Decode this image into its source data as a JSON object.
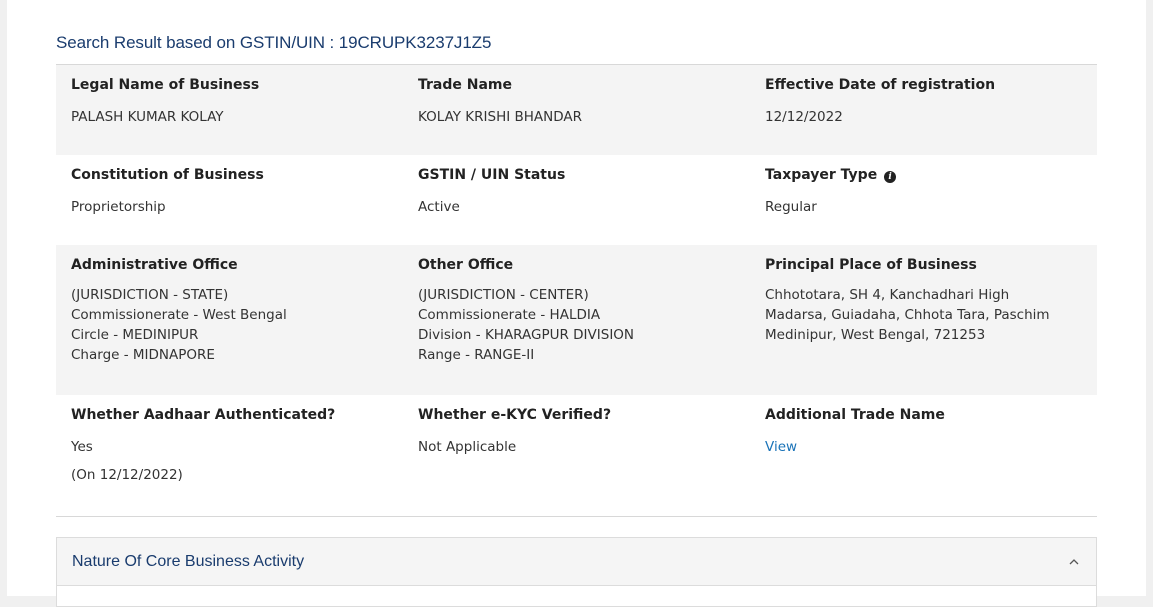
{
  "header": {
    "search_result_label": "Search Result based on GSTIN/UIN : 19CRUPK3237J1Z5"
  },
  "details": {
    "legal_name": {
      "label": "Legal Name of Business",
      "value": "PALASH KUMAR KOLAY"
    },
    "trade_name": {
      "label": "Trade Name",
      "value": "KOLAY KRISHI BHANDAR"
    },
    "effective_date": {
      "label": "Effective Date of registration",
      "value": "12/12/2022"
    },
    "constitution": {
      "label": "Constitution of Business",
      "value": "Proprietorship"
    },
    "status": {
      "label": "GSTIN / UIN Status",
      "value": "Active"
    },
    "taxpayer_type": {
      "label": "Taxpayer Type",
      "value": "Regular",
      "info_icon": "info-circle-icon"
    },
    "admin_office": {
      "label": "Administrative Office",
      "lines": [
        "(JURISDICTION - STATE)",
        "Commissionerate - West Bengal",
        "Circle - MEDINIPUR",
        "Charge - MIDNAPORE"
      ]
    },
    "other_office": {
      "label": "Other Office",
      "lines": [
        "(JURISDICTION - CENTER)",
        "Commissionerate - HALDIA",
        "Division - KHARAGPUR DIVISION",
        "Range - RANGE-II"
      ]
    },
    "principal_place": {
      "label": "Principal Place of Business",
      "lines": [
        "Chhototara, SH 4, Kanchadhari High",
        "Madarsa, Guiadaha, Chhota Tara, Paschim",
        "Medinipur, West Bengal, 721253"
      ]
    },
    "aadhaar": {
      "label": "Whether Aadhaar Authenticated?",
      "value": "Yes",
      "sub": "(On 12/12/2022)"
    },
    "ekyc": {
      "label": "Whether e-KYC Verified?",
      "value": "Not Applicable"
    },
    "additional_trade": {
      "label": "Additional Trade Name",
      "link": "View"
    }
  },
  "nature_panel": {
    "title": "Nature Of Core Business Activity",
    "toggle_icon": "chevron-up-icon"
  }
}
